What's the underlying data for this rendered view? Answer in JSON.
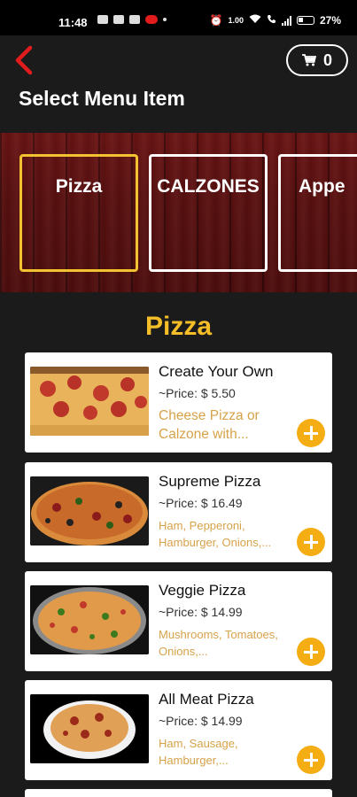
{
  "status_bar": {
    "time": "11:48",
    "battery": "27%",
    "net_speed": "1.00"
  },
  "header": {
    "title": "Select Menu Item",
    "cart_count": "0",
    "back_icon": "chevron-left-icon",
    "cart_icon": "cart-icon"
  },
  "categories": [
    {
      "label": "Pizza",
      "active": true
    },
    {
      "label": "CALZONES",
      "active": false
    },
    {
      "label": "Appe",
      "active": false
    }
  ],
  "menu": {
    "section_title": "Pizza",
    "items": [
      {
        "name": "Create Your Own",
        "price": "~Price: $ 5.50",
        "description": "Cheese Pizza or Calzone with..."
      },
      {
        "name": "Supreme Pizza",
        "price": "~Price: $ 16.49",
        "description": "Ham, Pepperoni, Hamburger, Onions,..."
      },
      {
        "name": "Veggie Pizza",
        "price": "~Price: $ 14.99",
        "description": "Mushrooms, Tomatoes, Onions,..."
      },
      {
        "name": "All Meat Pizza",
        "price": "~Price: $ 14.99",
        "description": "Ham, Sausage, Hamburger,..."
      }
    ]
  },
  "colors": {
    "accent": "#f5be28",
    "add_button": "#f5ad14",
    "back_icon": "#e21c1c",
    "description": "#d6a24a"
  }
}
